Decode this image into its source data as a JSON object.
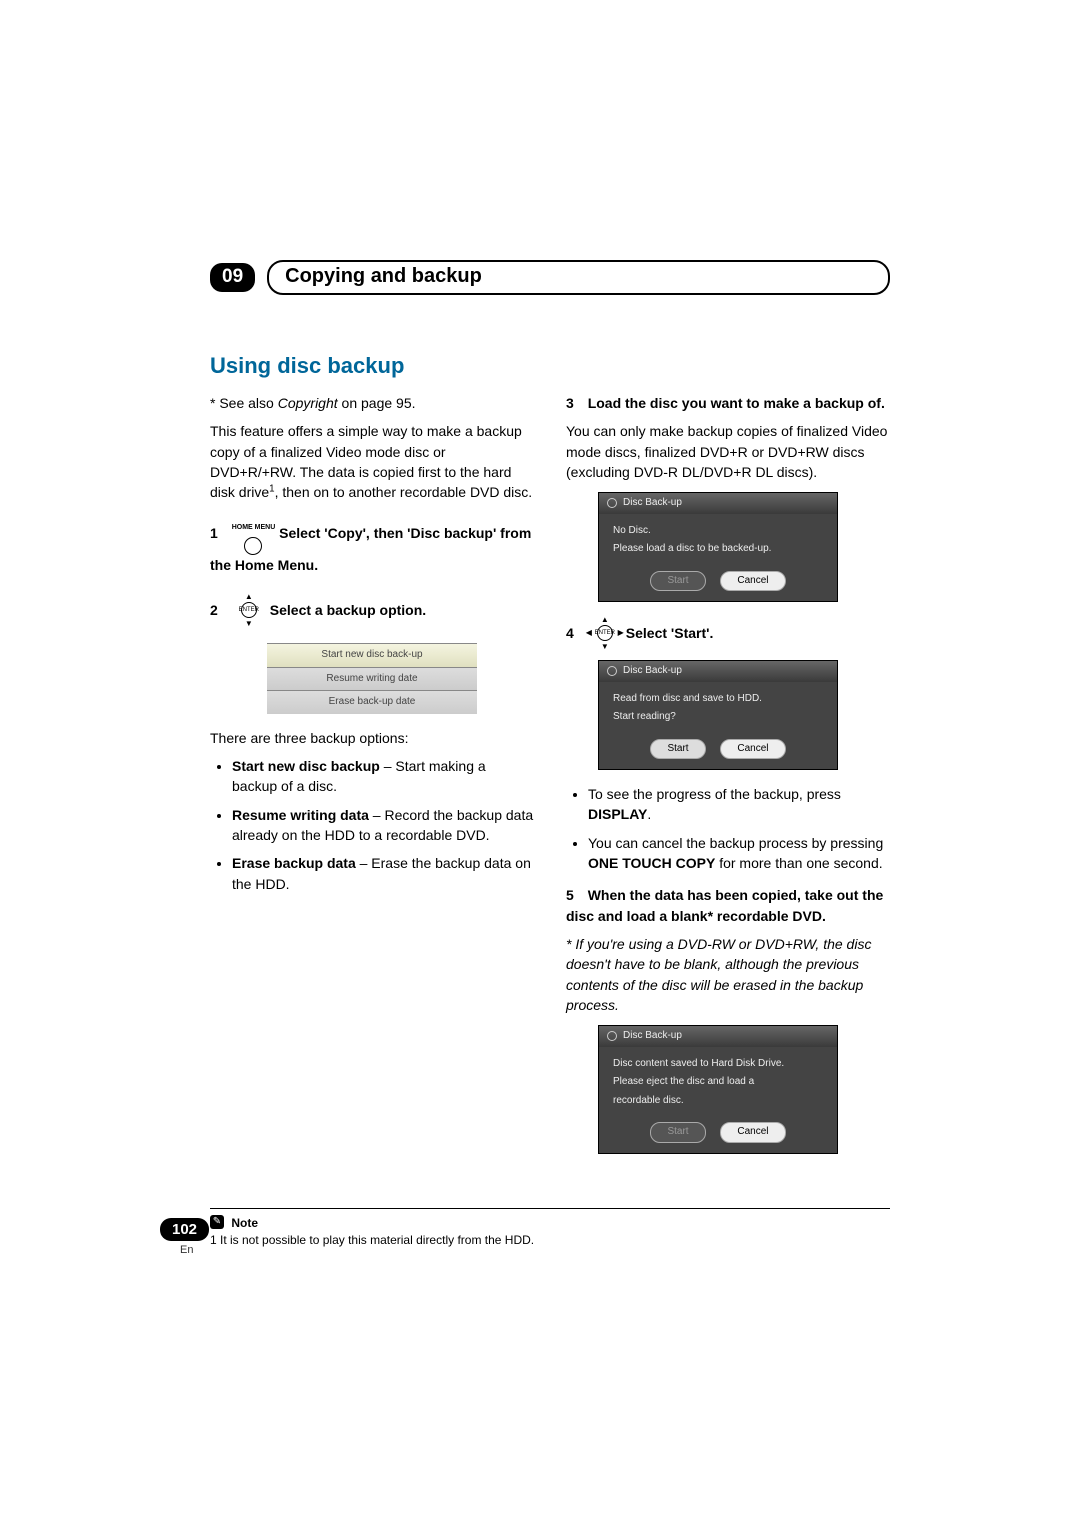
{
  "chapter": {
    "num": "09",
    "title": "Copying and backup"
  },
  "section_heading": "Using disc backup",
  "left": {
    "see_also_prefix": "* See also ",
    "see_also_italic": "Copyright",
    "see_also_suffix": " on page 95.",
    "intro": "This feature offers a simple way to make a backup copy of a finalized Video mode disc or DVD+R/+RW. The data is copied first to the hard disk drive",
    "intro_sup": "1",
    "intro_tail": ", then on to another recordable DVD disc.",
    "step1_num": "1",
    "step1_label": "HOME MENU",
    "step1_bold_a": "Select 'Copy', then 'Disc backup' from the Home Menu.",
    "step2_num": "2",
    "step2_bold": "Select a backup option.",
    "menu_items": [
      "Start new disc back-up",
      "Resume writing date",
      "Erase back-up date"
    ],
    "options_intro": "There are three backup options:",
    "opt1_bold": "Start new disc backup",
    "opt1_rest": " – Start making a backup of a disc.",
    "opt2_bold": "Resume writing data",
    "opt2_rest": " – Record the backup data already on the HDD to a recordable DVD.",
    "opt3_bold": "Erase backup data",
    "opt3_rest": " – Erase the backup data on the HDD."
  },
  "right": {
    "step3_num": "3",
    "step3_bold": "Load the disc you want to make a backup of.",
    "step3_body": "You can only make backup copies of finalized Video mode discs, finalized DVD+R or  DVD+RW discs (excluding DVD-R DL/DVD+R DL discs).",
    "win1_title": "Disc Back-up",
    "win1_l1": "No Disc.",
    "win1_l2": "Please load a disc to be backed-up.",
    "btn_start": "Start",
    "btn_cancel": "Cancel",
    "step4_num": "4",
    "step4_bold": "Select 'Start'.",
    "win2_title": "Disc Back-up",
    "win2_l1": "Read from disc and save to HDD.",
    "win2_l2": "Start reading?",
    "bullet1a": "To see the progress of the backup, press ",
    "bullet1b": "DISPLAY",
    "bullet1c": ".",
    "bullet2a": "You can cancel the backup process by pressing ",
    "bullet2b": "ONE TOUCH COPY",
    "bullet2c": " for more than one second.",
    "step5_num": "5",
    "step5_bold": "When the data has been copied, take out the disc and load a blank* recordable DVD.",
    "step5_italic": "* If you're using a DVD-RW or DVD+RW, the disc doesn't have to be blank, although the previous contents of the disc will be erased in the backup process.",
    "win3_title": "Disc Back-up",
    "win3_l1": "Disc content saved to Hard Disk Drive.",
    "win3_l2": "Please eject the disc and load a",
    "win3_l3": "recordable disc."
  },
  "footnote": {
    "label": "Note",
    "text": "1 It is not possible to play this material directly from the HDD."
  },
  "page_number": "102",
  "page_lang": "En",
  "enter_label": "ENTER"
}
